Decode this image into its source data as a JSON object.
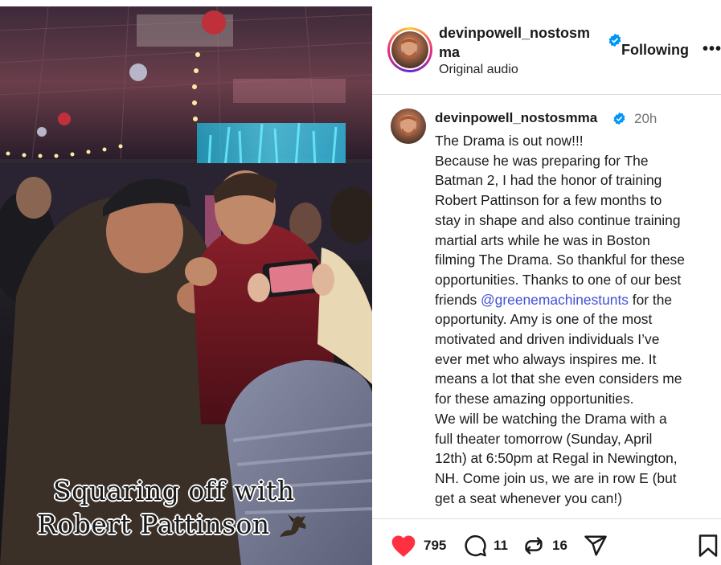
{
  "media": {
    "caption_line1": "Squaring off with",
    "caption_line2": "Robert Pattinson"
  },
  "header": {
    "username": "devinpowell_nostosmma",
    "audio": "Original audio",
    "follow_label": "Following",
    "more_label": "•••"
  },
  "post": {
    "username": "devinpowell_nostosmma",
    "time": "20h",
    "lines": [
      "The Drama is out now!!!",
      "Because he was preparing for The",
      "Batman 2, I had the honor of training",
      "Robert Pattinson for a few months to",
      "stay in shape and also continue training",
      "martial arts while he was in Boston",
      "filming The Drama. So thankful for these",
      "opportunities. Thanks to one of our best"
    ],
    "mention_prefix": "friends ",
    "mention": "@greenemachinestunts",
    "mention_suffix": " for the",
    "lines2": [
      "opportunity. Amy is one of the most",
      "motivated and driven individuals I’ve",
      "ever met who always inspires me. It",
      "means a lot that she even considers me",
      "for these amazing opportunities.",
      "We will be watching the Drama with a",
      "full theater tomorrow (Sunday, April",
      "12th) at 6:50pm at Regal in Newington,",
      "NH. Come join us, we are in row E (but",
      "get a seat whenever you can!)"
    ]
  },
  "actions": {
    "likes": "795",
    "comments": "11",
    "reposts": "16"
  },
  "colors": {
    "like": "#ff3040",
    "verified": "#0095f6",
    "mention": "#4150d8"
  },
  "icons": {
    "like": "heart-icon",
    "comment": "comment-icon",
    "repost": "repost-icon",
    "share": "send-icon",
    "save": "bookmark-icon",
    "verified": "verified-badge-icon"
  }
}
